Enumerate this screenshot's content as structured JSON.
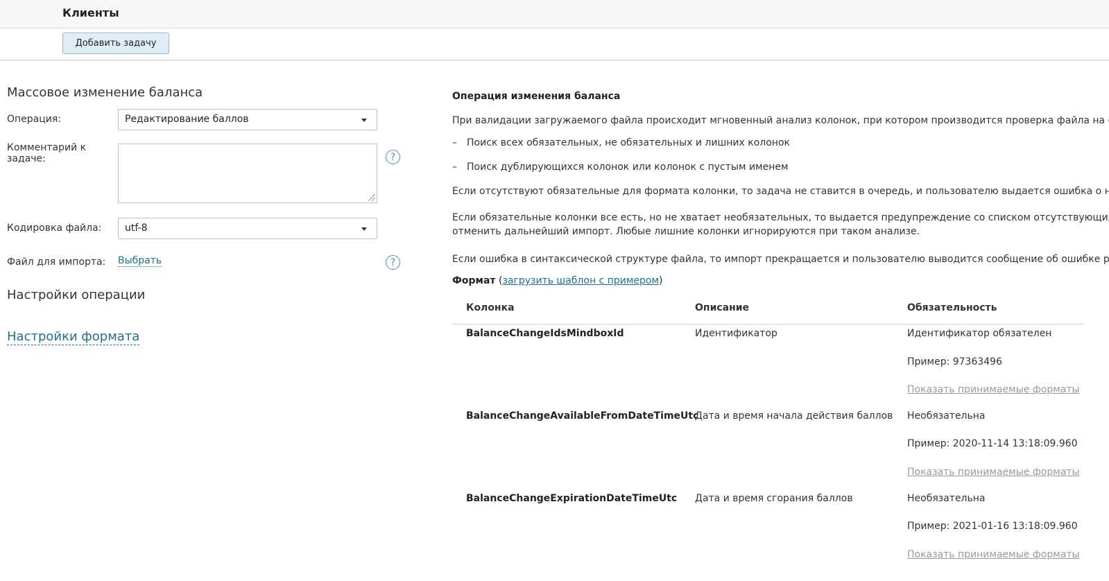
{
  "header": {
    "title": "Клиенты"
  },
  "toolbar": {
    "add_task_label": "Добавить задачу"
  },
  "form": {
    "title": "Массовое изменение баланса",
    "operation_label": "Операция:",
    "operation_value": "Редактирование баллов",
    "comment_label_line1": "Комментарий к",
    "comment_label_line2": "задаче:",
    "encoding_label": "Кодировка файла:",
    "encoding_value": "utf-8",
    "import_label": "Файл для импорта:",
    "choose_link": "Выбрать",
    "help_glyph": "?",
    "operation_settings_title": "Настройки операции",
    "format_settings_link": "Настройки формата"
  },
  "info": {
    "title": "Операция изменения баланса",
    "p1": "При валидации загружаемого файла происходит мгновенный анализ колонок, при котором производится проверка файла на соответс",
    "dash": "–",
    "bullet1": "Поиск всех обязательных, не обязательных и лишних колонок",
    "bullet2": "Поиск дублирующихся колонок или колонок с пустым именем",
    "p2": "Если отсутствуют обязательные для формата колонки, то задача не ставится в очередь, и пользователю выдается ошибка о невозможн",
    "p3_line1": "Если обязательные колонки все есть, но не хватает необязательных, то выдается предупреждение со списком отсутствующих колонок",
    "p3_line2": "отменить дальнейший импорт. Любые лишние колонки игнорируются при таком анализе.",
    "p4": "Если ошибка в синтаксической структуре файла, то импорт прекращается и пользователю выводится сообщение об ошибке разбора ф",
    "format_label": "Формат",
    "paren_open": "(",
    "template_link": "загрузить шаблон с примером",
    "paren_close": ")"
  },
  "table": {
    "headers": [
      "Колонка",
      "Описание",
      "Обязательность"
    ],
    "rows": [
      {
        "column": "BalanceChangeIdsMindboxId",
        "description": "Идентификатор",
        "requirement": "Идентификатор обязателен",
        "example": "Пример: 97363496",
        "show_formats": "Показать принимаемые форматы"
      },
      {
        "column": "BalanceChangeAvailableFromDateTimeUtc",
        "description": "Дата и время начала действия баллов",
        "requirement": "Необязательна",
        "example": "Пример: 2020-11-14 13:18:09.960",
        "show_formats": "Показать принимаемые форматы"
      },
      {
        "column": "BalanceChangeExpirationDateTimeUtc",
        "description": "Дата и время сгорания баллов",
        "requirement": "Необязательна",
        "example": "Пример: 2021-01-16 13:18:09.960",
        "show_formats": "Показать принимаемые форматы"
      }
    ]
  }
}
